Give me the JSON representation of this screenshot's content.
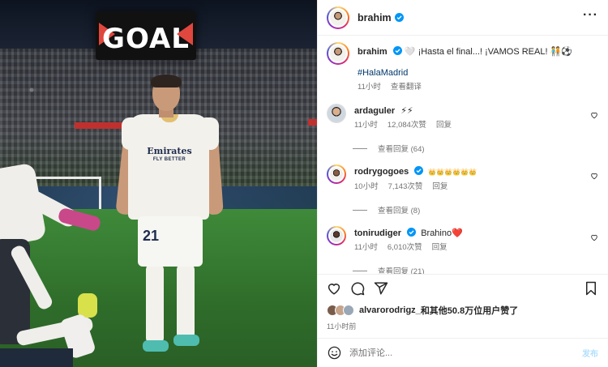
{
  "photo": {
    "scoreboard_text": "GOAL",
    "jersey_sponsor": "Emirates",
    "jersey_sponsor_sub": "FLY BETTER",
    "shorts_number": "21"
  },
  "post": {
    "author": "brahim",
    "caption_emoji": "🤍",
    "caption_text": "¡Hasta el final...! ¡VAMOS REAL! ",
    "caption_end_emoji": "🧑‍🤝‍🧑⚽",
    "hashtag": "#HalaMadrid",
    "time": "11小时",
    "see_translation": "查看翻译"
  },
  "comments": [
    {
      "username": "ardaguler",
      "verified": true,
      "text": "⚡⚡",
      "time": "11小时",
      "likes": "12,084次赞",
      "reply": "回复",
      "view_replies": "查看回复 (64)"
    },
    {
      "username": "rodrygogoes",
      "verified": true,
      "text": "👑👑👑👑👑👑",
      "time": "10小时",
      "likes": "7,143次赞",
      "reply": "回复",
      "view_replies": "查看回复 (8)"
    },
    {
      "username": "tonirudiger",
      "verified": true,
      "text": "Brahino❤️",
      "time": "11小时",
      "likes": "6,010次赞",
      "reply": "回复",
      "view_replies": "查看回复 (21)"
    }
  ],
  "likes_line": {
    "first_liker": "alvarorodrigz_",
    "rest": "和其他50.8万位用户赞了"
  },
  "post_time": "11小时前",
  "add_comment": {
    "placeholder": "添加评论...",
    "post_label": "发布"
  },
  "colors": {
    "verified": "#0095f6",
    "link": "#00376b",
    "post_button_disabled": "#b2dffc",
    "secondary_text": "#737373"
  },
  "icons": {
    "more": "more-horizontal-icon",
    "like": "heart-icon",
    "comment": "comment-bubble-icon",
    "share": "paper-plane-icon",
    "save": "bookmark-icon",
    "emoji": "smiley-icon"
  }
}
